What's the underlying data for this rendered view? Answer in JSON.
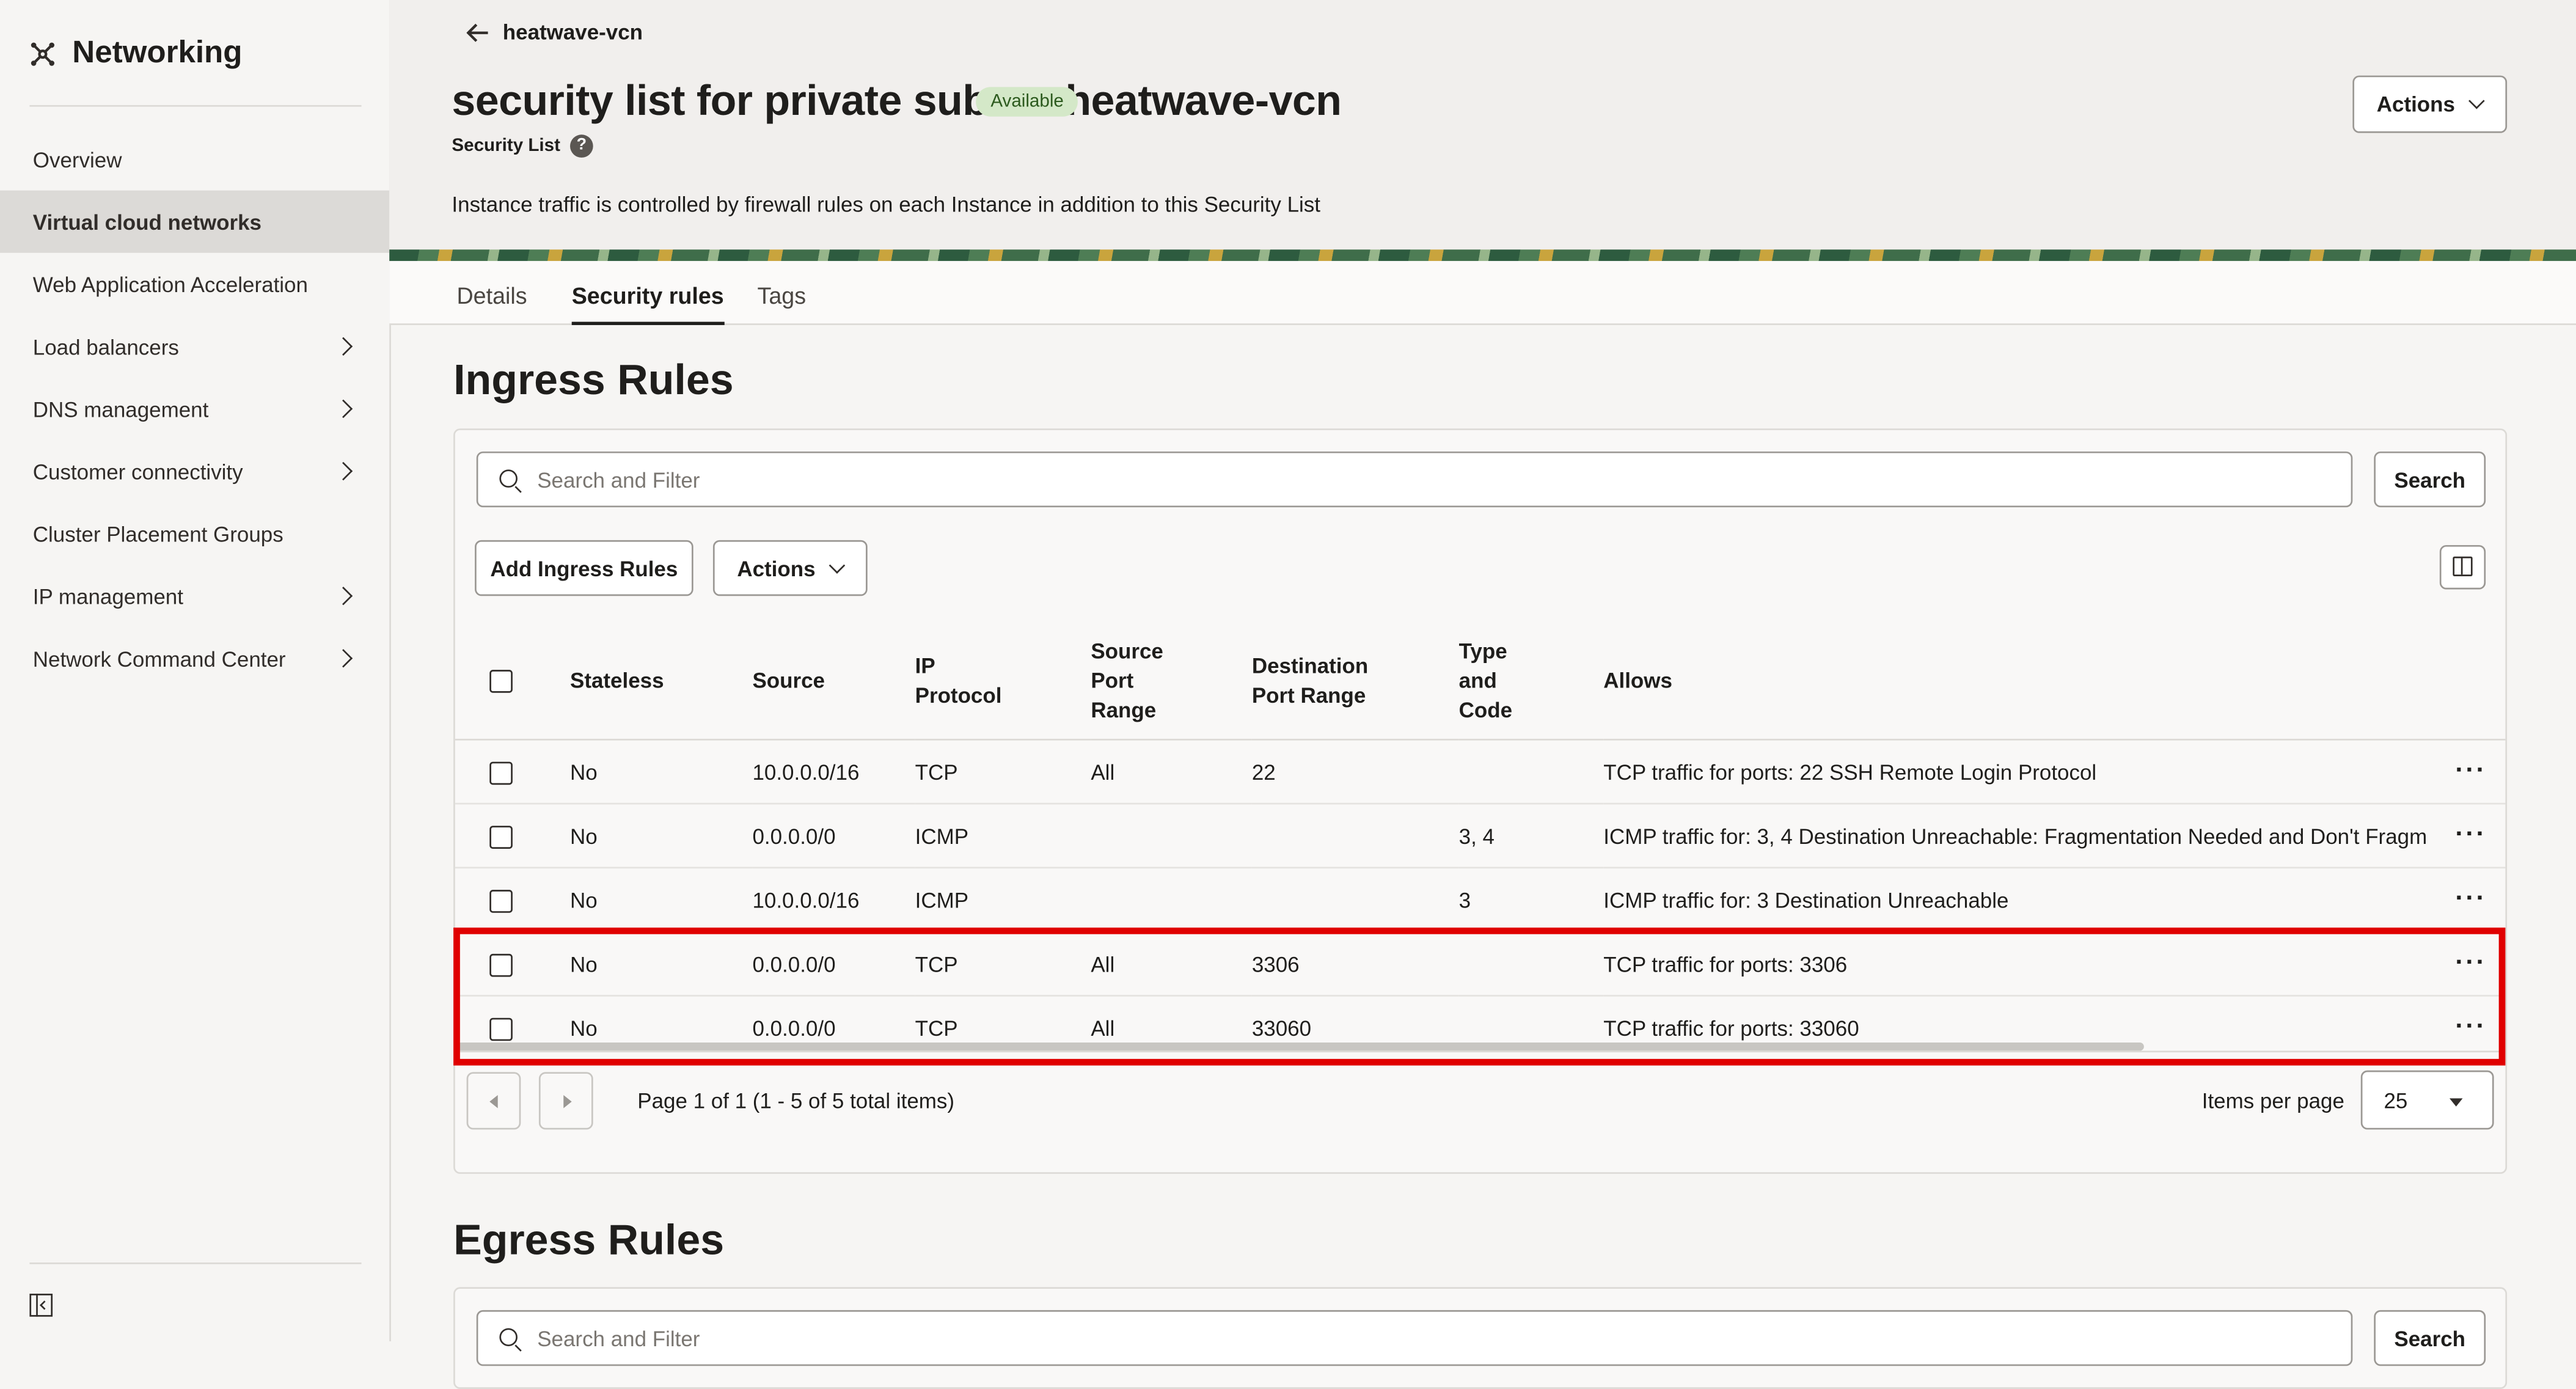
{
  "app": {
    "title": "Networking"
  },
  "sidebar": {
    "items": [
      {
        "label": "Overview",
        "active": false,
        "has_children": false
      },
      {
        "label": "Virtual cloud networks",
        "active": true,
        "has_children": false
      },
      {
        "label": "Web Application Acceleration",
        "active": false,
        "has_children": false
      },
      {
        "label": "Load balancers",
        "active": false,
        "has_children": true
      },
      {
        "label": "DNS management",
        "active": false,
        "has_children": true
      },
      {
        "label": "Customer connectivity",
        "active": false,
        "has_children": true
      },
      {
        "label": "Cluster Placement Groups",
        "active": false,
        "has_children": false
      },
      {
        "label": "IP management",
        "active": false,
        "has_children": true
      },
      {
        "label": "Network Command Center",
        "active": false,
        "has_children": true
      }
    ]
  },
  "header": {
    "back_label": "heatwave-vcn",
    "title": "security list for private subnet-heatwave-vcn",
    "status_badge": "Available",
    "subtitle": "Security List",
    "description": "Instance traffic is controlled by firewall rules on each Instance in addition to this Security List",
    "actions_label": "Actions"
  },
  "tabs": [
    {
      "label": "Details",
      "active": false
    },
    {
      "label": "Security rules",
      "active": true
    },
    {
      "label": "Tags",
      "active": false
    }
  ],
  "ingress": {
    "title": "Ingress Rules",
    "search_placeholder": "Search and Filter",
    "search_button": "Search",
    "add_button": "Add Ingress Rules",
    "actions_label": "Actions",
    "columns": [
      "Stateless",
      "Source",
      "IP Protocol",
      "Source Port Range",
      "Destination Port Range",
      "Type and Code",
      "Allows"
    ],
    "rows": [
      {
        "stateless": "No",
        "source": "10.0.0.0/16",
        "protocol": "TCP",
        "src_port": "All",
        "dst_port": "22",
        "type_code": "",
        "allows": "TCP traffic for ports: 22 SSH Remote Login Protocol"
      },
      {
        "stateless": "No",
        "source": "0.0.0.0/0",
        "protocol": "ICMP",
        "src_port": "",
        "dst_port": "",
        "type_code": "3, 4",
        "allows": "ICMP traffic for: 3, 4 Destination Unreachable: Fragmentation Needed and Don't Fragm"
      },
      {
        "stateless": "No",
        "source": "10.0.0.0/16",
        "protocol": "ICMP",
        "src_port": "",
        "dst_port": "",
        "type_code": "3",
        "allows": "ICMP traffic for: 3 Destination Unreachable"
      },
      {
        "stateless": "No",
        "source": "0.0.0.0/0",
        "protocol": "TCP",
        "src_port": "All",
        "dst_port": "3306",
        "type_code": "",
        "allows": "TCP traffic for ports: 3306"
      },
      {
        "stateless": "No",
        "source": "0.0.0.0/0",
        "protocol": "TCP",
        "src_port": "All",
        "dst_port": "33060",
        "type_code": "",
        "allows": "TCP traffic for ports: 33060"
      }
    ],
    "pagination": "Page 1 of 1 (1 - 5 of 5 total items)",
    "items_per_page_label": "Items per page",
    "items_per_page_value": "25"
  },
  "egress": {
    "title": "Egress Rules",
    "search_placeholder": "Search and Filter",
    "search_button": "Search"
  },
  "colors": {
    "highlight": "#e00000",
    "badge_bg": "#d4e8c8",
    "active_nav": "#dcdad7"
  }
}
